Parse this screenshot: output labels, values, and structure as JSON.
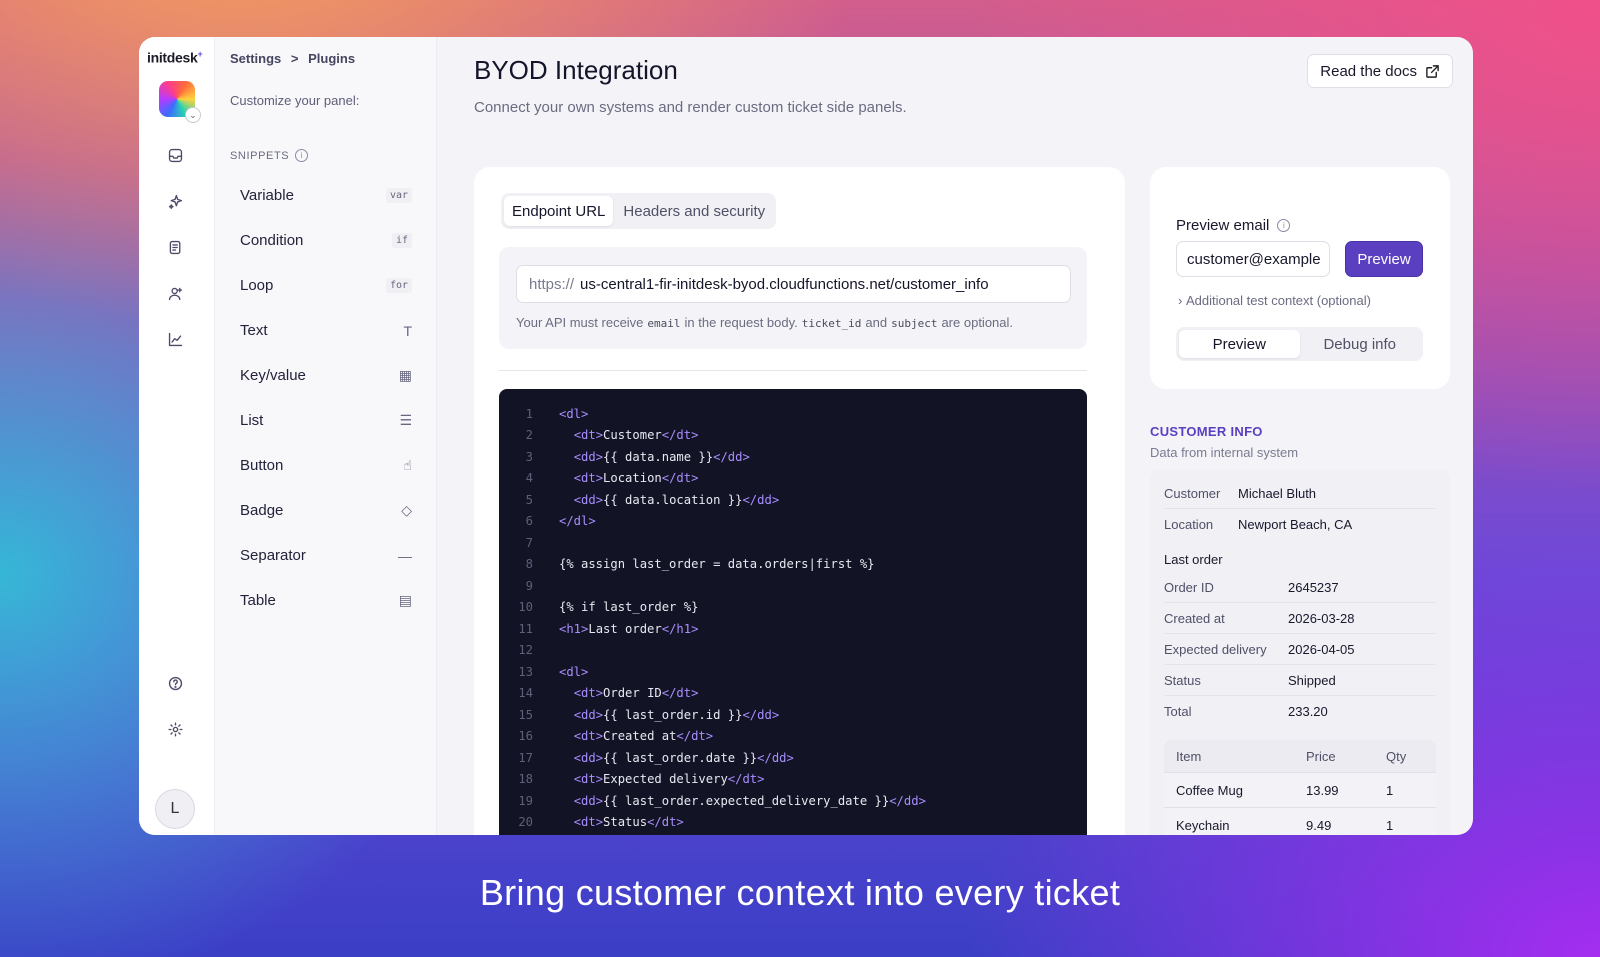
{
  "app": {
    "logo": "initdesk",
    "logo_mark": "+"
  },
  "rail": {
    "user_initial": "L"
  },
  "breadcrumb": {
    "settings": "Settings",
    "separator": ">",
    "plugins": "Plugins"
  },
  "snippets": {
    "customize_label": "Customize your panel:",
    "title": "SNIPPETS",
    "info": "i",
    "items": [
      {
        "label": "Variable",
        "badge": "var"
      },
      {
        "label": "Condition",
        "badge": "if"
      },
      {
        "label": "Loop",
        "badge": "for"
      },
      {
        "label": "Text",
        "glyph": "T"
      },
      {
        "label": "Key/value",
        "glyph": "▦"
      },
      {
        "label": "List",
        "glyph": "☰"
      },
      {
        "label": "Button",
        "glyph": "☝"
      },
      {
        "label": "Badge",
        "glyph": "◇"
      },
      {
        "label": "Separator",
        "glyph": "—"
      },
      {
        "label": "Table",
        "glyph": "▤"
      }
    ]
  },
  "page": {
    "title": "BYOD Integration",
    "subtitle": "Connect your own systems and render custom ticket side panels.",
    "docs_button": "Read the docs"
  },
  "tabs": [
    "Endpoint URL",
    "Headers and security"
  ],
  "endpoint": {
    "prefix": "https://",
    "url": "us-central1-fir-initdesk-byod.cloudfunctions.net/customer_info",
    "hint_1": "Your API must receive",
    "hint_code_1": "email",
    "hint_2": "in the request body.",
    "hint_code_2": "ticket_id",
    "hint_3": "and",
    "hint_code_3": "subject",
    "hint_4": "are optional."
  },
  "code_lines": [
    "<dl>",
    "  <dt>Customer</dt>",
    "  <dd>{{ data.name }}</dd>",
    "  <dt>Location</dt>",
    "  <dd>{{ data.location }}</dd>",
    "</dl>",
    "",
    "{% assign last_order = data.orders|first %}",
    "",
    "{% if last_order %}",
    "<h1>Last order</h1>",
    "",
    "<dl>",
    "  <dt>Order ID</dt>",
    "  <dd>{{ last_order.id }}</dd>",
    "  <dt>Created at</dt>",
    "  <dd>{{ last_order.date }}</dd>",
    "  <dt>Expected delivery</dt>",
    "  <dd>{{ last_order.expected_delivery_date }}</dd>",
    "  <dt>Status</dt>"
  ],
  "preview": {
    "label": "Preview email",
    "info": "i",
    "email_value": "customer@example",
    "button": "Preview",
    "extra": "Additional test context (optional)",
    "segments": [
      "Preview",
      "Debug info"
    ]
  },
  "customer_info": {
    "title": "CUSTOMER INFO",
    "subtitle": "Data from internal system",
    "customer": {
      "key": "Customer",
      "value": "Michael Bluth"
    },
    "location": {
      "key": "Location",
      "value": "Newport Beach, CA"
    },
    "last_order_heading": "Last order",
    "order_rows": [
      {
        "key": "Order ID",
        "value": "2645237"
      },
      {
        "key": "Created at",
        "value": "2026-03-28"
      },
      {
        "key": "Expected delivery",
        "value": "2026-04-05"
      },
      {
        "key": "Status",
        "value": "Shipped"
      },
      {
        "key": "Total",
        "value": "233.20"
      }
    ],
    "table_headers": [
      "Item",
      "Price",
      "Qty"
    ],
    "table_rows": [
      [
        "Coffee Mug",
        "13.99",
        "1"
      ],
      [
        "Keychain",
        "9.49",
        "1"
      ]
    ]
  },
  "headline": "Bring customer context into every ticket"
}
